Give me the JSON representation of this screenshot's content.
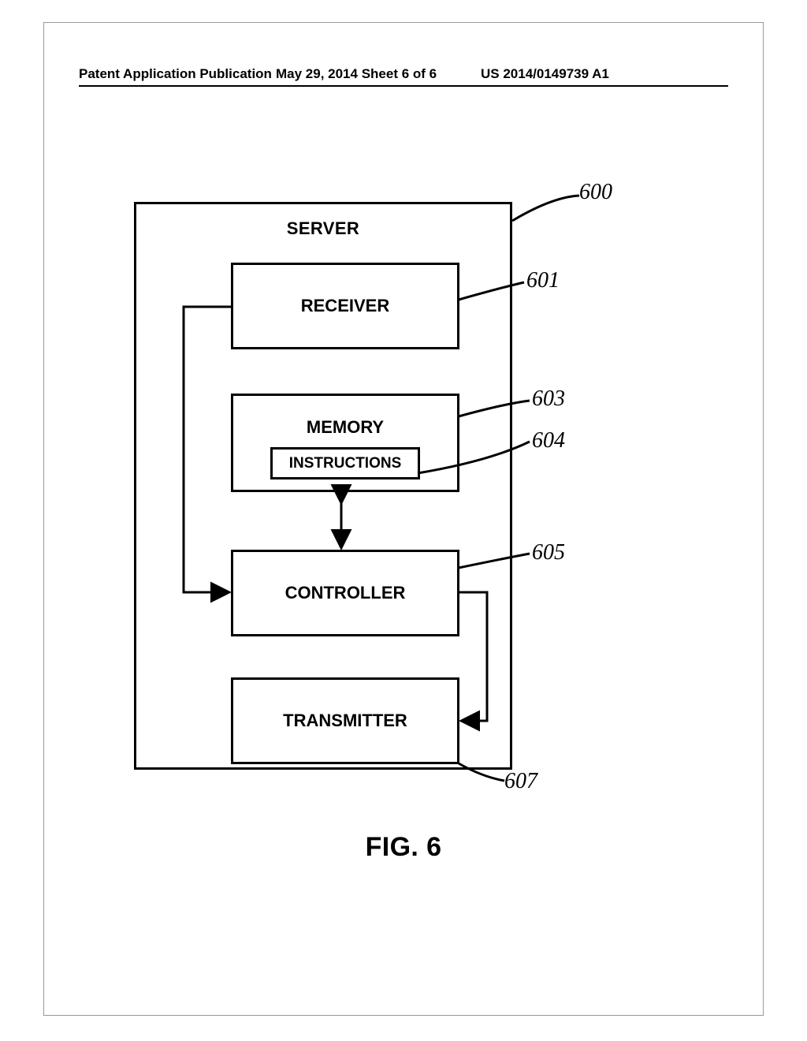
{
  "header": {
    "left": "Patent Application Publication",
    "mid": "May 29, 2014  Sheet 6 of 6",
    "right": "US 2014/0149739 A1"
  },
  "diagram": {
    "outer_label": "SERVER",
    "blocks": {
      "receiver": "RECEIVER",
      "memory": "MEMORY",
      "instructions": "INSTRUCTIONS",
      "controller": "CONTROLLER",
      "transmitter": "TRANSMITTER"
    },
    "refs": {
      "server": "600",
      "receiver": "601",
      "memory": "603",
      "instructions": "604",
      "controller": "605",
      "transmitter": "607"
    }
  },
  "figure_caption": "FIG. 6"
}
